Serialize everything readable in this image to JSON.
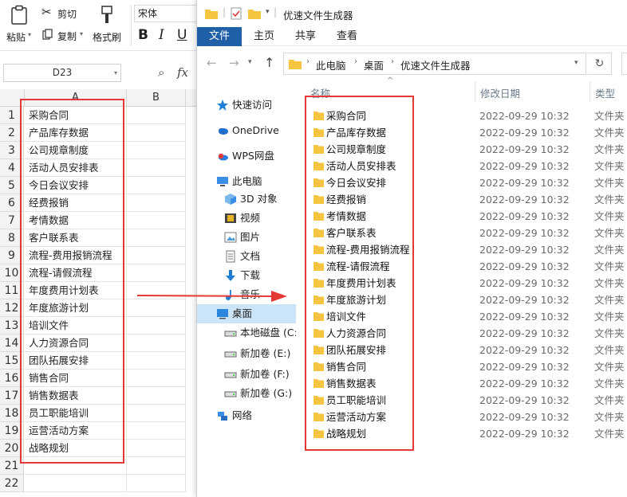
{
  "spreadsheet": {
    "ribbon": {
      "paste": "粘贴",
      "cut": "剪切",
      "copy": "复制",
      "format_painter": "格式刷",
      "font_name": "宋体",
      "bold": "B",
      "italic": "I",
      "underline": "U"
    },
    "name_box": "D23",
    "fx_label": "fx",
    "columns": [
      "A",
      "B"
    ],
    "row_numbers": [
      "1",
      "2",
      "3",
      "4",
      "5",
      "6",
      "7",
      "8",
      "9",
      "10",
      "11",
      "12",
      "13",
      "14",
      "15",
      "16",
      "17",
      "18",
      "19",
      "20",
      "21",
      "22"
    ],
    "cells": [
      "采购合同",
      "产品库存数据",
      "公司规章制度",
      "活动人员安排表",
      "今日会议安排",
      "经费报销",
      "考情数据",
      "客户联系表",
      "流程-费用报销流程",
      "流程-请假流程",
      "年度费用计划表",
      "年度旅游计划",
      "培训文件",
      "人力资源合同",
      "团队拓展安排",
      "销售合同",
      "销售数据表",
      "员工职能培训",
      "运营活动方案",
      "战略规划"
    ]
  },
  "explorer": {
    "title": "优速文件生成器",
    "tabs": [
      {
        "label": "文件",
        "active": true
      },
      {
        "label": "主页",
        "active": false
      },
      {
        "label": "共享",
        "active": false
      },
      {
        "label": "查看",
        "active": false
      }
    ],
    "breadcrumb": [
      "此电脑",
      "桌面",
      "优速文件生成器"
    ],
    "nav": [
      {
        "label": "快速访问",
        "icon": "star-icon"
      },
      {
        "label": "OneDrive",
        "icon": "cloud-icon"
      },
      {
        "label": "WPS网盘",
        "icon": "wps-cloud-icon"
      },
      {
        "label": "此电脑",
        "icon": "computer-icon"
      },
      {
        "label": "3D 对象",
        "icon": "cube-icon"
      },
      {
        "label": "视频",
        "icon": "video-icon"
      },
      {
        "label": "图片",
        "icon": "picture-icon"
      },
      {
        "label": "文档",
        "icon": "document-icon"
      },
      {
        "label": "下载",
        "icon": "download-icon"
      },
      {
        "label": "音乐",
        "icon": "music-icon"
      },
      {
        "label": "桌面",
        "icon": "desktop-icon",
        "selected": true
      },
      {
        "label": "本地磁盘 (C:)",
        "icon": "drive-icon"
      },
      {
        "label": "新加卷 (E:)",
        "icon": "drive-icon"
      },
      {
        "label": "新加卷 (F:)",
        "icon": "drive-icon"
      },
      {
        "label": "新加卷 (G:)",
        "icon": "drive-icon"
      },
      {
        "label": "网络",
        "icon": "network-icon"
      }
    ],
    "columns": {
      "name": "名称",
      "modified": "修改日期",
      "type": "类型"
    },
    "files": [
      {
        "name": "采购合同",
        "date": "2022-09-29 10:32",
        "type": "文件夹"
      },
      {
        "name": "产品库存数据",
        "date": "2022-09-29 10:32",
        "type": "文件夹"
      },
      {
        "name": "公司规章制度",
        "date": "2022-09-29 10:32",
        "type": "文件夹"
      },
      {
        "name": "活动人员安排表",
        "date": "2022-09-29 10:32",
        "type": "文件夹"
      },
      {
        "name": "今日会议安排",
        "date": "2022-09-29 10:32",
        "type": "文件夹"
      },
      {
        "name": "经费报销",
        "date": "2022-09-29 10:32",
        "type": "文件夹"
      },
      {
        "name": "考情数据",
        "date": "2022-09-29 10:32",
        "type": "文件夹"
      },
      {
        "name": "客户联系表",
        "date": "2022-09-29 10:32",
        "type": "文件夹"
      },
      {
        "name": "流程-费用报销流程",
        "date": "2022-09-29 10:32",
        "type": "文件夹"
      },
      {
        "name": "流程-请假流程",
        "date": "2022-09-29 10:32",
        "type": "文件夹"
      },
      {
        "name": "年度费用计划表",
        "date": "2022-09-29 10:32",
        "type": "文件夹"
      },
      {
        "name": "年度旅游计划",
        "date": "2022-09-29 10:32",
        "type": "文件夹"
      },
      {
        "name": "培训文件",
        "date": "2022-09-29 10:32",
        "type": "文件夹"
      },
      {
        "name": "人力资源合同",
        "date": "2022-09-29 10:32",
        "type": "文件夹"
      },
      {
        "name": "团队拓展安排",
        "date": "2022-09-29 10:32",
        "type": "文件夹"
      },
      {
        "name": "销售合同",
        "date": "2022-09-29 10:32",
        "type": "文件夹"
      },
      {
        "name": "销售数据表",
        "date": "2022-09-29 10:32",
        "type": "文件夹"
      },
      {
        "name": "员工职能培训",
        "date": "2022-09-29 10:32",
        "type": "文件夹"
      },
      {
        "name": "运营活动方案",
        "date": "2022-09-29 10:32",
        "type": "文件夹"
      },
      {
        "name": "战略规划",
        "date": "2022-09-29 10:32",
        "type": "文件夹"
      }
    ]
  },
  "colors": {
    "highlight_red": "#e53935",
    "ribbon_active": "#1f5fa8",
    "nav_selected": "#cce4f7",
    "folder_yellow": "#f5c542"
  }
}
